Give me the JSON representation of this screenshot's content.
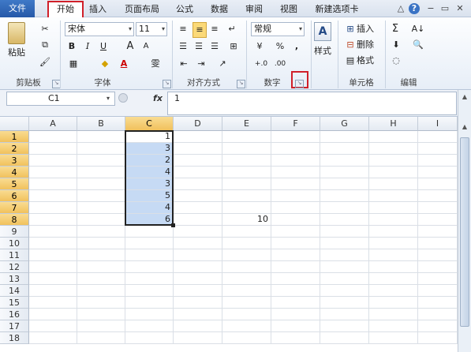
{
  "tabs": {
    "file": "文件",
    "home": "开始",
    "insert": "插入",
    "page_layout": "页面布局",
    "formulas": "公式",
    "data": "数据",
    "review": "审阅",
    "view": "视图",
    "new_tab": "新建选项卡"
  },
  "window_controls": {
    "collapse": "△",
    "help": "?",
    "minimize": "−",
    "restore": "▭",
    "close": "✕"
  },
  "ribbon": {
    "clipboard": {
      "paste": "粘贴",
      "label": "剪贴板"
    },
    "font": {
      "name": "宋体",
      "size": "11",
      "bold": "B",
      "italic": "I",
      "underline": "U",
      "grow": "A",
      "shrink": "A",
      "color": "A",
      "label": "字体"
    },
    "alignment": {
      "label": "对齐方式"
    },
    "number": {
      "format": "常规",
      "percent": "%",
      "comma": ",",
      "label": "数字"
    },
    "styles": {
      "styles": "样式"
    },
    "cells": {
      "insert": "插入",
      "delete": "删除",
      "format": "格式",
      "label": "单元格"
    },
    "editing": {
      "sum": "Σ",
      "label": "编辑"
    }
  },
  "formula_bar": {
    "name_box": "C1",
    "fx": "fx",
    "content": "1"
  },
  "columns": [
    "A",
    "B",
    "C",
    "D",
    "E",
    "F",
    "G",
    "H",
    "I"
  ],
  "rows": [
    "1",
    "2",
    "3",
    "4",
    "5",
    "6",
    "7",
    "8",
    "9",
    "10",
    "11",
    "12",
    "13",
    "14",
    "15",
    "16",
    "17",
    "18"
  ],
  "cells": {
    "C1": "1",
    "C2": "3",
    "C3": "2",
    "C4": "4",
    "C5": "3",
    "C6": "5",
    "C7": "4",
    "C8": "6",
    "E8": "10"
  },
  "colors": {
    "selection_fill": "#c6daf4",
    "header_highlight": "#f1c15c",
    "highlight_box": "#d0202a",
    "file_tab": "#2659a8"
  }
}
